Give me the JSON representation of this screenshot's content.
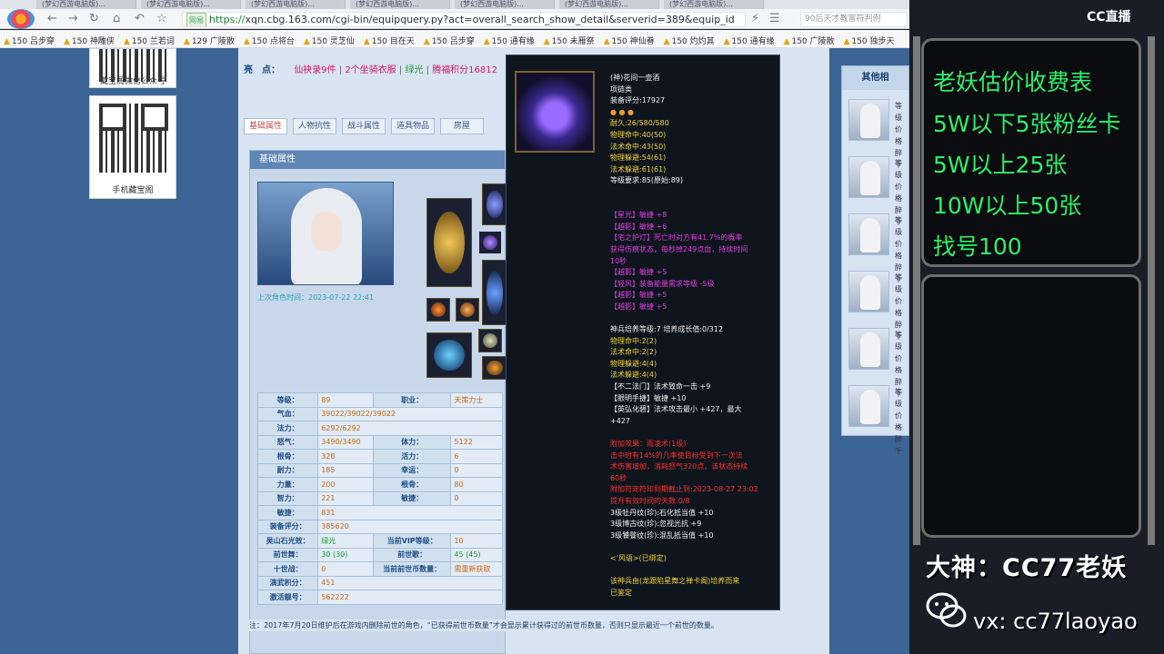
{
  "browser": {
    "tabs": [
      "(梦幻西游电脑版)...",
      "(梦幻西游电脑版)...",
      "(梦幻西游电脑版)...",
      "(梦幻西游电脑版)...",
      "(梦幻西游电脑版)...",
      "(梦幻西游电脑版)...",
      "(梦幻西游电脑版)..."
    ],
    "url_tag": "网易",
    "url_scheme": "https://",
    "url_rest": "xqn.cbg.163.com/cgi-bin/equipquery.py?act=overall_search_show_detail&serverid=389&equip_id",
    "search_hint": "90后天才教富符判例",
    "bookmarks": [
      "150 吕步穿",
      "150 神雕侠",
      "150 兰若词",
      "129 广陵散",
      "150 点将台",
      "150 灵芝仙",
      "150 目在天",
      "150 吕步穿",
      "150 通有缘",
      "150 未雁祭",
      "150 神仙眷",
      "150 灼灼其",
      "150 通有缘",
      "150 广陵散",
      "150 独步天"
    ]
  },
  "sidebar": {
    "wechat_caption": "藏宝阁微信公众号",
    "mobile_caption": "手机藏宝阁"
  },
  "highlight": {
    "key": "亮　点：",
    "items": [
      "仙袂录9件",
      "2个坐骑衣服",
      "绿光",
      "腾福积分16812"
    ],
    "sep": "|"
  },
  "tabs": [
    "基础属性",
    "人物抗性",
    "战斗属性",
    "道具物品",
    "房屋"
  ],
  "panel": {
    "title": "基础属性",
    "last_login": "上次角色时间：2023-07-22 22:41"
  },
  "stats": [
    [
      "等级：",
      "89",
      "职业：",
      "天策力士"
    ],
    [
      "气血：",
      "39022/39022/39022",
      "",
      ""
    ],
    [
      "法力：",
      "6292/6292",
      "",
      ""
    ],
    [
      "怒气：",
      "3490/3490",
      "体力：",
      "5122"
    ],
    [
      "根骨：",
      "328",
      "活力：",
      "6"
    ],
    [
      "耐力：",
      "185",
      "幸运：",
      "0"
    ],
    [
      "力量：",
      "200",
      "根骨：",
      "80"
    ],
    [
      "智力：",
      "221",
      "敏捷：",
      "0"
    ],
    [
      "敏捷：",
      "831",
      "",
      ""
    ],
    [
      "装备评分：",
      "385620",
      "",
      ""
    ],
    [
      "吴山石光效：",
      "绿光",
      "当前VIP等级：",
      "10"
    ],
    [
      "前世舞：",
      "30 (30)",
      "前世歌：",
      "45 (45)"
    ],
    [
      "十世战：",
      "0",
      "当前前世币数量：",
      "需重新获取"
    ],
    [
      "演武积分：",
      "451",
      "",
      ""
    ],
    [
      "激活靓号：",
      "562222",
      "",
      ""
    ]
  ],
  "note": "注：2017年7月20日维护后在游戏内删除前世的角色，“已获得前世币数量”才会显示累计获得过的前世币数量，否则只显示最近一个前世的数量。",
  "other": {
    "title": "其他相",
    "items": [
      "等级\n价格\n醉千",
      "等级\n价格\n醉千",
      "等级\n价格\n醉千",
      "等级\n价格\n醉千",
      "等级\n价格\n醉千",
      "等级\n价格\n醉千"
    ]
  },
  "tooltip": {
    "lines": [
      {
        "t": "(神)花间一壶酒",
        "c": "white"
      },
      {
        "t": "项链类",
        "c": "white"
      },
      {
        "t": "装备评分:17927",
        "c": "white"
      },
      {
        "t": "● ● ●",
        "c": "orange"
      },
      {
        "t": "耐久:26/580/580",
        "c": "yellow"
      },
      {
        "t": "物理命中:40(50)",
        "c": "yellow"
      },
      {
        "t": "法术命中:43(50)",
        "c": "yellow"
      },
      {
        "t": "物理躲避:54(61)",
        "c": "yellow"
      },
      {
        "t": "法术躲避:61(61)",
        "c": "yellow"
      },
      {
        "t": "等级要求:85(原始:89)",
        "c": "white"
      },
      {
        "t": "",
        "c": "white"
      },
      {
        "t": "",
        "c": "white"
      },
      {
        "t": "【星光】敏捷 +8",
        "c": "magenta"
      },
      {
        "t": "【越影】敏捷 +6",
        "c": "magenta"
      },
      {
        "t": "【宅之护灯】死亡时对方有41.7%的概率",
        "c": "magenta"
      },
      {
        "t": "获得伤痕状态，每秒掉249点血，持续时间",
        "c": "magenta"
      },
      {
        "t": "10秒",
        "c": "magenta"
      },
      {
        "t": "【越影】敏捷 +5",
        "c": "magenta"
      },
      {
        "t": "【轻风】装备能量需求等级 -5级",
        "c": "magenta"
      },
      {
        "t": "【越影】敏捷 +5",
        "c": "magenta"
      },
      {
        "t": "【越影】敏捷 +5",
        "c": "magenta"
      },
      {
        "t": "",
        "c": "white"
      },
      {
        "t": "神兵培养等级:7 培养成长值:0/312",
        "c": "white"
      },
      {
        "t": "物理命中:2(2)",
        "c": "yellow"
      },
      {
        "t": "法术命中:2(2)",
        "c": "yellow"
      },
      {
        "t": "物理躲避:4(4)",
        "c": "yellow"
      },
      {
        "t": "法术躲避:4(4)",
        "c": "yellow"
      },
      {
        "t": "【不二法门】法术致命一击 +9",
        "c": "white"
      },
      {
        "t": "【眼明手捷】敏捷 +10",
        "c": "white"
      },
      {
        "t": "【英弘化碧】法术攻击最小 +427，最大",
        "c": "white"
      },
      {
        "t": "+427",
        "c": "white"
      },
      {
        "t": "",
        "c": "white"
      },
      {
        "t": "附加效果：雨凌术(1级)",
        "c": "red"
      },
      {
        "t": "击中时有14%的几率使目标受到下一次法",
        "c": "red"
      },
      {
        "t": "术伤害增加，消耗怒气320点，该状态持续",
        "c": "red"
      },
      {
        "t": "60秒",
        "c": "red"
      },
      {
        "t": "附加符宠符印到期截止到:2023-08-27 23:02",
        "c": "red"
      },
      {
        "t": "提升有效时间的天数:0/8",
        "c": "red"
      },
      {
        "t": "3级牡丹纹(珍):石化抵当值 +10",
        "c": "white"
      },
      {
        "t": "3级博古纹(珍):忽视光抗 +9",
        "c": "white"
      },
      {
        "t": "3级饕餮纹(珍):混乱抵当值 +10",
        "c": "white"
      },
      {
        "t": "",
        "c": "white"
      },
      {
        "t": "<'风语>(已绑定)",
        "c": "yellow"
      },
      {
        "t": "",
        "c": "white"
      },
      {
        "t": "该神兵由(龙跟陷星舞之禅卡阁)培养而来",
        "c": "yellow"
      },
      {
        "t": "已鉴定",
        "c": "yellow"
      }
    ]
  },
  "stream": {
    "logo": "CC直播",
    "price_lines": [
      "老妖估价收费表",
      "5W以下5张粉丝卡",
      "5W以上25张",
      "10W以上50张",
      "找号100"
    ],
    "name": "大神：CC77老妖",
    "vx": "vx: cc77laoyao",
    "accent": "#2cf06a"
  }
}
